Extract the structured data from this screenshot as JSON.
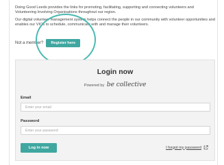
{
  "intro": {
    "paragraph1": "Doing Good Leeds provides the links for promoting, facilitating, supporting and connecting volunteers and Volunteering Involving Organisations throughout our region.",
    "paragraph2": "Our digital volunteer management system helps connect the people in our community with volunteer opportunities and enables our VIOs to schedule, communicate with and manage their volunteers."
  },
  "member": {
    "prompt": "Not a member?",
    "register_label": "Register here"
  },
  "login": {
    "title": "Login now",
    "powered_by": "Powered by",
    "brand": "be collective",
    "email_label": "Email",
    "email_placeholder": "Enter your email",
    "password_label": "Password",
    "password_placeholder": "Enter your password",
    "submit_label": "Log in now",
    "forgot_label": "I forgot my password",
    "forgot_icon": "external-link-icon"
  },
  "colors": {
    "accent": "#3fa7a0",
    "highlight": "#4ab9b1",
    "panel": "#f3f3f3"
  }
}
